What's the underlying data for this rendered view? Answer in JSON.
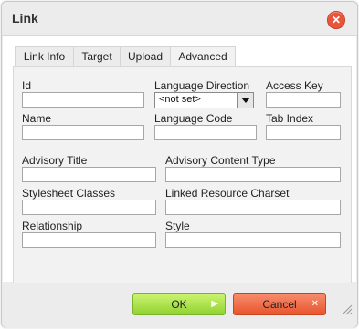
{
  "dialog": {
    "title": "Link",
    "close_icon": "close-icon"
  },
  "tabs": [
    {
      "label": "Link Info"
    },
    {
      "label": "Target"
    },
    {
      "label": "Upload"
    },
    {
      "label": "Advanced",
      "active": true
    }
  ],
  "fields": {
    "id": {
      "label": "Id",
      "value": ""
    },
    "language_direction": {
      "label": "Language Direction",
      "value": "<not set>"
    },
    "access_key": {
      "label": "Access Key",
      "value": ""
    },
    "name": {
      "label": "Name",
      "value": ""
    },
    "language_code": {
      "label": "Language Code",
      "value": ""
    },
    "tab_index": {
      "label": "Tab Index",
      "value": ""
    },
    "advisory_title": {
      "label": "Advisory Title",
      "value": ""
    },
    "advisory_content_type": {
      "label": "Advisory Content Type",
      "value": ""
    },
    "stylesheet_classes": {
      "label": "Stylesheet Classes",
      "value": ""
    },
    "linked_resource_charset": {
      "label": "Linked Resource Charset",
      "value": ""
    },
    "relationship": {
      "label": "Relationship",
      "value": ""
    },
    "style": {
      "label": "Style",
      "value": ""
    }
  },
  "buttons": {
    "ok": "OK",
    "cancel": "Cancel"
  },
  "colors": {
    "ok_button": "#91d231",
    "cancel_button": "#e8552d",
    "close_button": "#e8553a"
  }
}
